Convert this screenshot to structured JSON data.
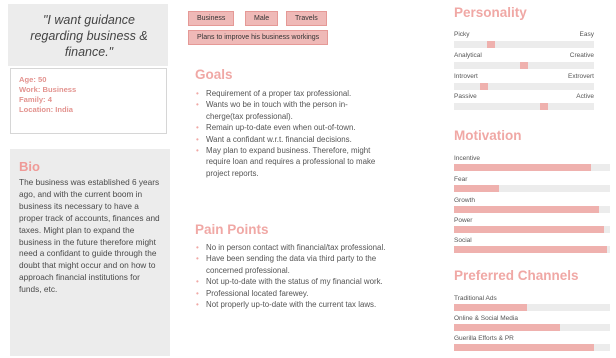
{
  "quote": "\"I want guidance regarding business & finance.\"",
  "facts": [
    "Age: 50",
    "Work: Business",
    "Family: 4",
    "Location: India"
  ],
  "bio": {
    "title": "Bio",
    "text": "The business was established 6 years ago, and with the current boom in business its necessary to have a proper track of accounts, finances and taxes. Might plan to expand the business in the future therefore might need a confidant to guide through the doubt that might occur and on how to approach financial institutions for funds, etc."
  },
  "tags": [
    "Business",
    "Male",
    "Travels"
  ],
  "tag_wide": "Plans to improve his business workings",
  "goals": {
    "title": "Goals",
    "items": [
      "Requirement of a proper tax professional.",
      "Wants wo be in touch with the person in-",
      "cherge(tax professional).",
      "Remain up-to-date even when out-of-town.",
      "Want a confidant w.r.t. financial decisions.",
      "May plan to expand business. Therefore, might",
      "require loan and requires a professional to make",
      "project reports."
    ]
  },
  "pain_points": {
    "title": "Pain Points",
    "items": [
      "No in person contact with financial/tax professional.",
      "Have been sending the data via third party to the",
      "concerned professional.",
      "Not up-to-date with the status of my financial work.",
      "Professional located farewey.",
      "Not properly up-to-date with the current tax laws."
    ]
  },
  "personality": {
    "title": "Personality",
    "scales": [
      {
        "left": "Picky",
        "right": "Easy",
        "value": 0.25
      },
      {
        "left": "Analytical",
        "right": "Creative",
        "value": 0.5
      },
      {
        "left": "Introvert",
        "right": "Extrovert",
        "value": 0.2
      },
      {
        "left": "Passive",
        "right": "Active",
        "value": 0.65
      }
    ]
  },
  "motivation": {
    "title": "Motivation",
    "items": [
      {
        "label": "Incentive",
        "value": 0.88
      },
      {
        "label": "Fear",
        "value": 0.29
      },
      {
        "label": "Growth",
        "value": 0.93
      },
      {
        "label": "Power",
        "value": 0.96
      },
      {
        "label": "Social",
        "value": 0.98
      }
    ]
  },
  "channels": {
    "title": "Preferred Channels",
    "items": [
      {
        "label": "Traditional Ads",
        "value": 0.47
      },
      {
        "label": "Online & Social Media",
        "value": 0.68
      },
      {
        "label": "Guerilla Efforts & PR",
        "value": 0.9
      }
    ]
  },
  "colors": {
    "accent": "#f0a8a5",
    "bar_fill": "#efb1ae",
    "track": "#ececec",
    "tag_bg": "#efb9b7"
  }
}
